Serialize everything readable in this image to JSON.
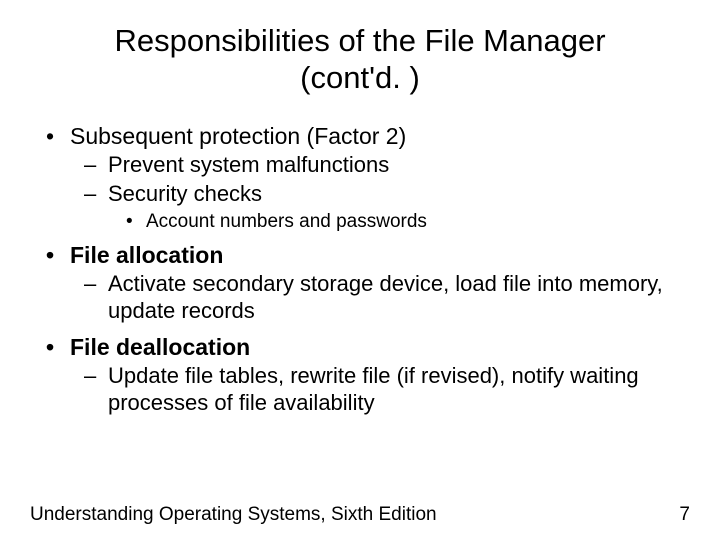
{
  "title_line1": "Responsibilities of the File Manager",
  "title_line2": "(cont'd. )",
  "bullets": {
    "b1": "Subsequent protection (Factor 2)",
    "b1a": "Prevent system malfunctions",
    "b1b": "Security checks",
    "b1b1": "Account numbers and passwords",
    "b2": "File allocation",
    "b2a": "Activate secondary storage device, load file into memory, update records",
    "b3": "File deallocation",
    "b3a": "Update file tables, rewrite file (if revised), notify waiting processes of file availability"
  },
  "footer": {
    "source": "Understanding Operating Systems, Sixth Edition",
    "page": "7"
  }
}
